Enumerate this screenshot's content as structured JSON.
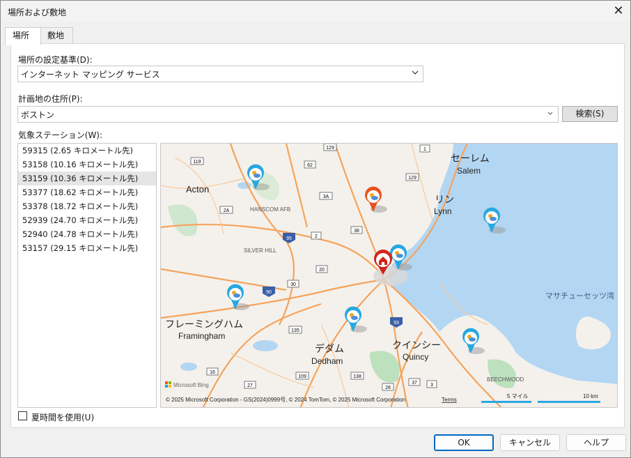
{
  "window": {
    "title": "場所および敷地",
    "close_glyph": "✕"
  },
  "tabs": [
    {
      "label": "場所"
    },
    {
      "label": "敷地"
    }
  ],
  "location_basis": {
    "label": "場所の設定基準(D):",
    "value": "インターネット マッピング サービス"
  },
  "address": {
    "label": "計画地の住所(P):",
    "value": "ボストン",
    "search_button": "検索(S)"
  },
  "stations": {
    "label": "気象ステーション(W):",
    "items": [
      "59315 (2.65 キロメートル先)",
      "53158 (10.16 キロメートル先)",
      "53159 (10.36 キロメートル先)",
      "53377 (18.62 キロメートル先)",
      "53378 (18.72 キロメートル先)",
      "52939 (24.70 キロメートル先)",
      "52940 (24.78 キロメートル先)",
      "53157 (29.15 キロメートル先)"
    ],
    "selected_index": 2
  },
  "map": {
    "place_labels": {
      "acton": "Acton",
      "salem_jp": "セーレム",
      "salem": "Salem",
      "lynn_jp": "リン",
      "lynn": "Lynn",
      "hanscom": "HANSCOM AFB",
      "silver_hill": "SILVER HILL",
      "framingham_jp": "フレーミングハム",
      "framingham": "Framingham",
      "dedham_jp": "デダム",
      "dedham": "Dedham",
      "quincy_jp": "クインシー",
      "quincy": "Quincy",
      "beechwood": "BEECHWOOD",
      "bay": "マサチューセッツ湾"
    },
    "route_shields": [
      "129",
      "1",
      "119",
      "62",
      "129",
      "3A",
      "2A",
      "95",
      "2",
      "38",
      "20",
      "90",
      "30",
      "135",
      "93",
      "16",
      "109",
      "138",
      "28",
      "27",
      "37",
      "3"
    ],
    "brand": "Microsoft Bing",
    "copyright": "© 2025 Microsoft Corporation - GS(2024)0999号, © 2024 TomTom, © 2025 Microsoft Corporation",
    "terms": "Terms",
    "scale_miles": "5 マイル",
    "scale_km": "10 km"
  },
  "dst": {
    "label": "夏時間を使用(U)",
    "checked": false
  },
  "buttons": {
    "ok": "OK",
    "cancel": "キャンセル",
    "help": "ヘルプ"
  }
}
